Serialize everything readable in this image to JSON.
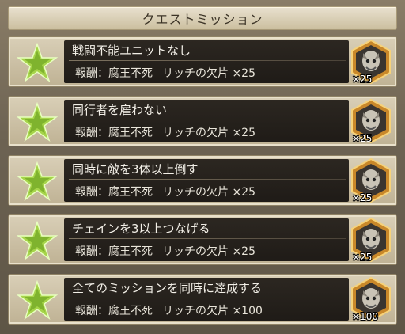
{
  "header": {
    "title": "クエストミッション"
  },
  "missions": [
    {
      "name": "戦闘不能ユニットなし",
      "reward_label": "報酬：",
      "reward_item": "腐王不死",
      "reward_piece": "リッチの欠片",
      "reward_count": "×25",
      "badge_qty": "×25"
    },
    {
      "name": "同行者を雇わない",
      "reward_label": "報酬：",
      "reward_item": "腐王不死",
      "reward_piece": "リッチの欠片",
      "reward_count": "×25",
      "badge_qty": "×25"
    },
    {
      "name": "同時に敵を3体以上倒す",
      "reward_label": "報酬：",
      "reward_item": "腐王不死",
      "reward_piece": "リッチの欠片",
      "reward_count": "×25",
      "badge_qty": "×25"
    },
    {
      "name": "チェインを3以上つなげる",
      "reward_label": "報酬：",
      "reward_item": "腐王不死",
      "reward_piece": "リッチの欠片",
      "reward_count": "×25",
      "badge_qty": "×25"
    },
    {
      "name": "全てのミッションを同時に達成する",
      "reward_label": "報酬：",
      "reward_item": "腐王不死",
      "reward_piece": "リッチの欠片",
      "reward_count": "×100",
      "badge_qty": "×100"
    }
  ],
  "icons": {
    "mission_status": "green-star-icon",
    "reward_item": "lich-fragment-icon"
  },
  "colors": {
    "star": "#9ccf3a",
    "item_frame": "#d69a2c",
    "text_light": "#f2efe7"
  }
}
